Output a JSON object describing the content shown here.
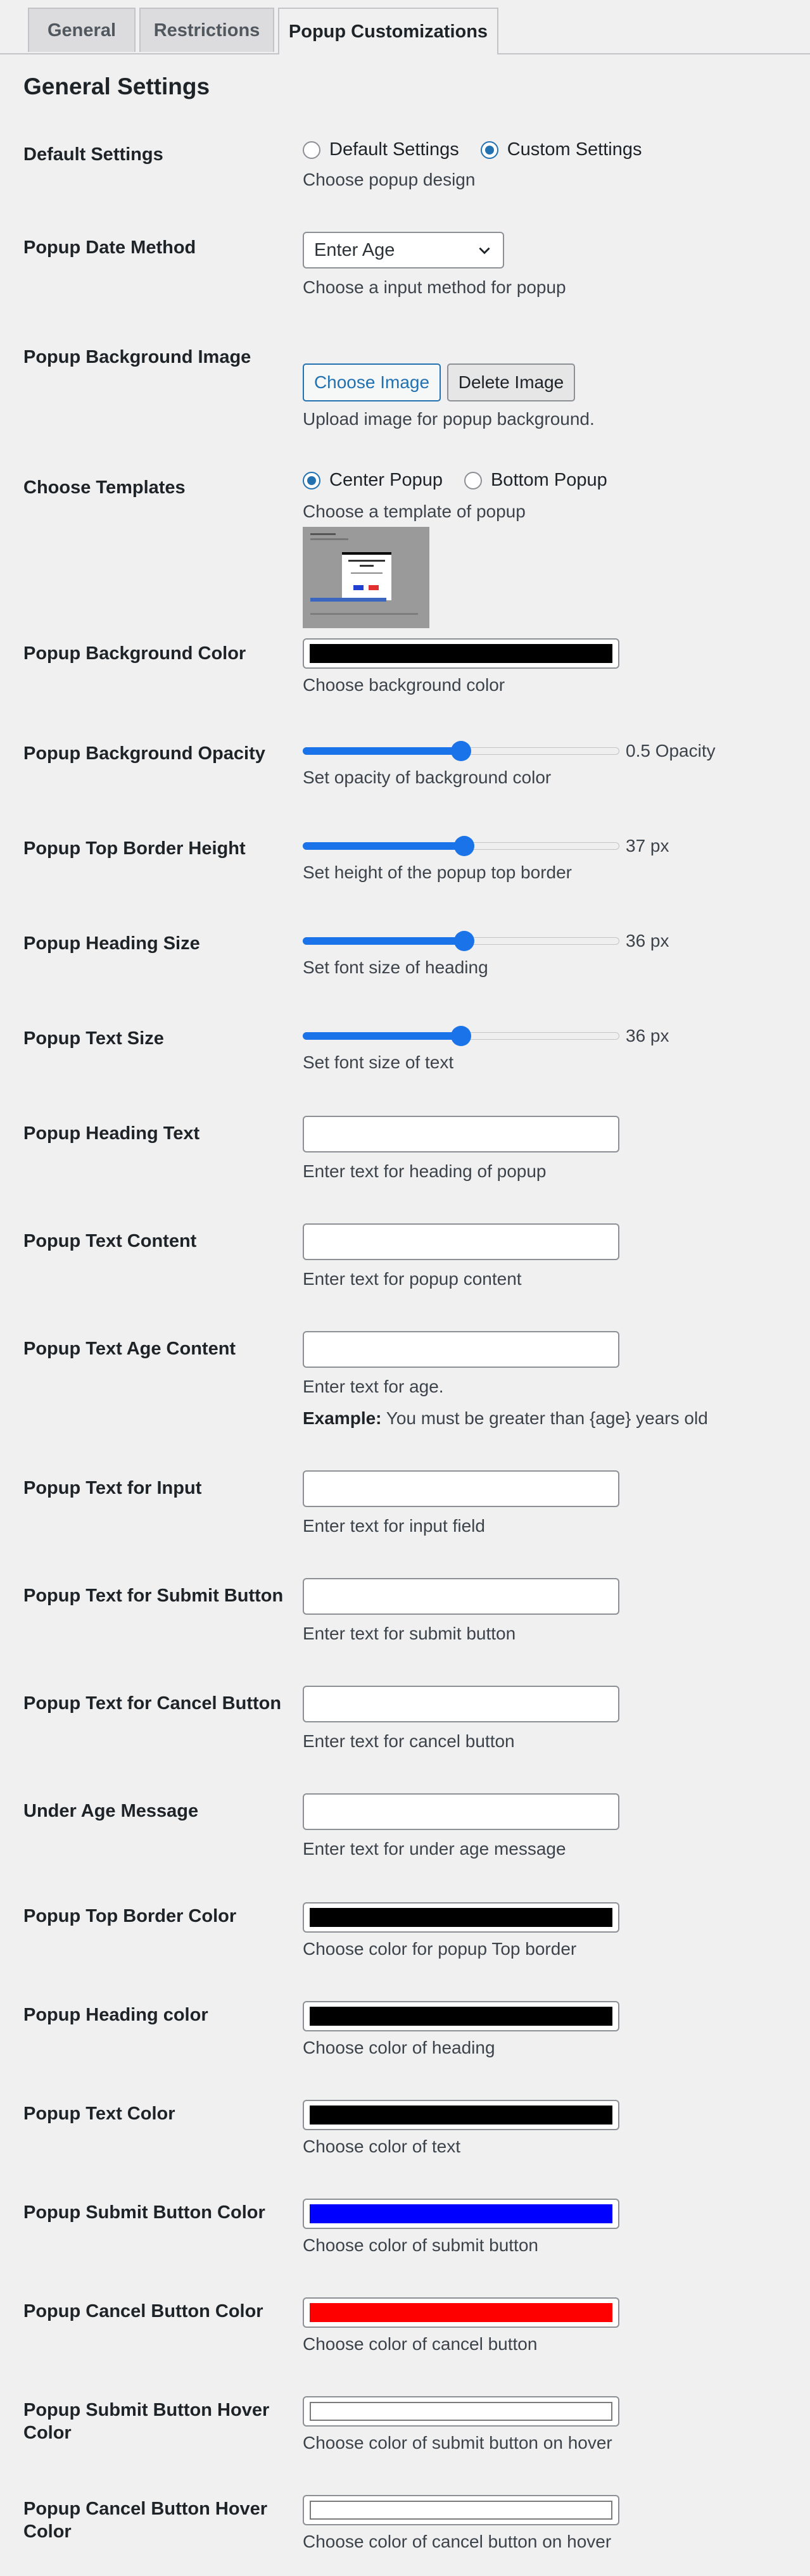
{
  "tabs": [
    "General",
    "Restrictions",
    "Popup Customizations"
  ],
  "section_title": "General Settings",
  "default_settings": {
    "label": "Default Settings",
    "options": [
      "Default Settings",
      "Custom Settings"
    ],
    "selected": "Custom Settings",
    "desc": "Choose popup design"
  },
  "date_method": {
    "label": "Popup Date Method",
    "value": "Enter Age",
    "desc": "Choose a input method for popup"
  },
  "bg_image": {
    "label": "Popup Background Image",
    "choose_label": "Choose Image",
    "delete_label": "Delete Image",
    "desc": "Upload image for popup background."
  },
  "templates": {
    "label": "Choose Templates",
    "options": [
      "Center Popup",
      "Bottom Popup"
    ],
    "selected": "Center Popup",
    "desc": "Choose a template of popup"
  },
  "bg_color": {
    "label": "Popup Background Color",
    "color": "#000000",
    "desc": "Choose background color"
  },
  "sliders": [
    {
      "label": "Popup Background Opacity",
      "value_text": "0.5 Opacity",
      "fraction": 0.5,
      "desc": "Set opacity of background color"
    },
    {
      "label": "Popup Top Border Height",
      "value_text": "37 px",
      "fraction": 0.51,
      "desc": "Set height of the popup top border"
    },
    {
      "label": "Popup Heading Size",
      "value_text": "36 px",
      "fraction": 0.51,
      "desc": "Set font size of heading"
    },
    {
      "label": "Popup Text Size",
      "value_text": "36 px",
      "fraction": 0.5,
      "desc": "Set font size of text"
    }
  ],
  "text_fields": [
    {
      "label": "Popup Heading Text",
      "value": "",
      "desc": "Enter text for heading of popup"
    },
    {
      "label": "Popup Text Content",
      "value": "",
      "desc": "Enter text for popup content"
    },
    {
      "label": "Popup Text Age Content",
      "value": "",
      "desc": "Enter text for age.",
      "example_label": "Example:",
      "example_text": " You must be greater than {age} years old"
    },
    {
      "label": "Popup Text for Input",
      "value": "",
      "desc": "Enter text for input field"
    },
    {
      "label": "Popup Text for Submit Button",
      "value": "",
      "desc": "Enter text for submit button"
    },
    {
      "label": "Popup Text for Cancel Button",
      "value": "",
      "desc": "Enter text for cancel button"
    },
    {
      "label": "Under Age Message",
      "value": "",
      "desc": "Enter text for under age message"
    }
  ],
  "color_fields": [
    {
      "label": "Popup Top Border Color",
      "color": "#000000",
      "desc": "Choose color for popup Top border"
    },
    {
      "label": "Popup Heading color",
      "color": "#000000",
      "desc": "Choose color of heading"
    },
    {
      "label": "Popup Text Color",
      "color": "#000000",
      "desc": "Choose color of text"
    },
    {
      "label": "Popup Submit Button Color",
      "color": "#0000ff",
      "desc": "Choose color of submit button"
    },
    {
      "label": "Popup Cancel Button Color",
      "color": "#ff0000",
      "desc": "Choose color of cancel button"
    },
    {
      "label": "Popup Submit Button Hover Color",
      "color": "#ffffff",
      "desc": "Choose color of submit button on hover"
    },
    {
      "label": "Popup Cancel Button Hover Color",
      "color": "#ffffff",
      "desc": "Choose color of cancel button on hover"
    }
  ]
}
